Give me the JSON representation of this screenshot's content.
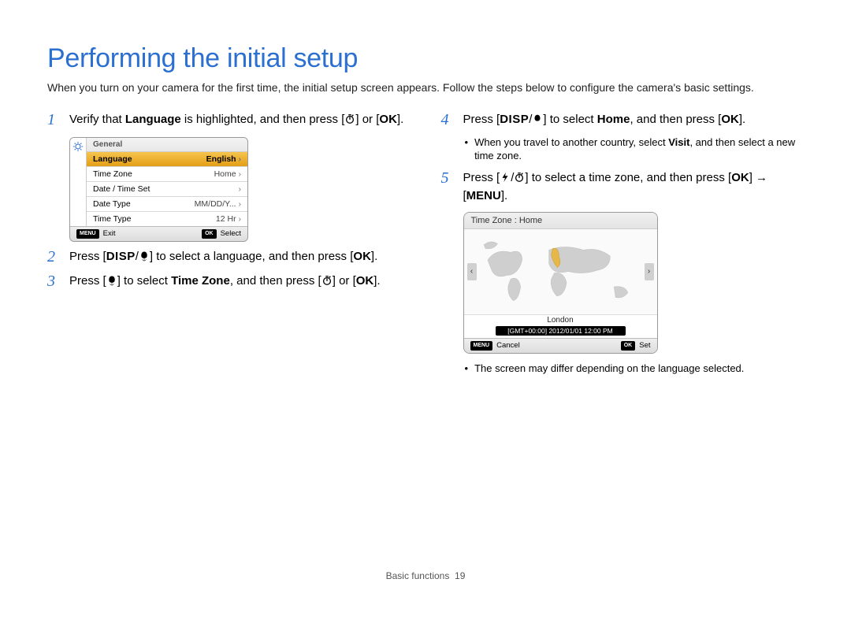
{
  "title": "Performing the initial setup",
  "intro": "When you turn on your camera for the first time, the initial setup screen appears. Follow the steps below to configure the camera's basic settings.",
  "steps": {
    "1": {
      "prefix": "Verify that ",
      "bold": "Language",
      "suffix": " is highlighted, and then press"
    },
    "2": {
      "text": "to select a language, and then press"
    },
    "3": {
      "prefix": "to select ",
      "bold": "Time Zone",
      "suffix": ", and then press"
    },
    "4": {
      "prefix": "to select ",
      "bold": "Home",
      "suffix": ", and then press"
    },
    "4b": {
      "prefix": "When you travel to another country, select ",
      "bold": "Visit",
      "suffix": ", and then select a new time zone."
    },
    "5": {
      "text": "to select a time zone, and then press"
    },
    "5b": "The screen may differ depending on the language selected."
  },
  "labels": {
    "disp": "DISP",
    "ok": "OK",
    "menu": "MENU",
    "or": "or",
    "arrow": "→",
    "press": "Press"
  },
  "cam_menu": {
    "header": "General",
    "rows": [
      {
        "k": "Language",
        "v": "English",
        "sel": true
      },
      {
        "k": "Time Zone",
        "v": "Home"
      },
      {
        "k": "Date / Time Set",
        "v": ""
      },
      {
        "k": "Date Type",
        "v": "MM/DD/Y..."
      },
      {
        "k": "Time Type",
        "v": "12 Hr"
      }
    ],
    "foot_left": "Exit",
    "foot_right": "Select"
  },
  "tz": {
    "header": "Time Zone : Home",
    "city": "London",
    "gmt": "[GMT+00:00] 2012/01/01 12:00 PM",
    "foot_left": "Cancel",
    "foot_right": "Set"
  },
  "footer": {
    "section": "Basic functions",
    "page": "19"
  }
}
